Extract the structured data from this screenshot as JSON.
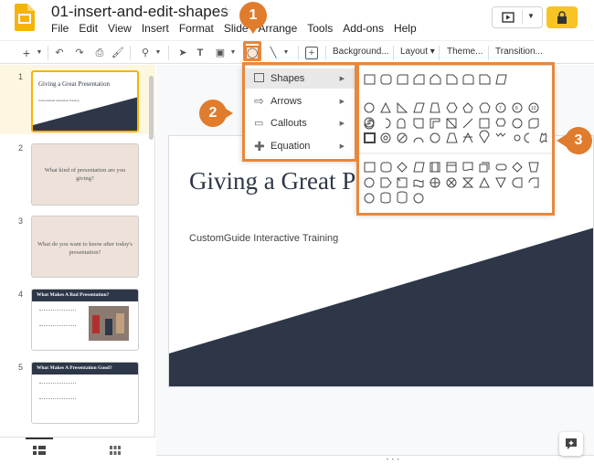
{
  "app": {
    "doc_title": "01-insert-and-edit-shapes",
    "menu": [
      "File",
      "Edit",
      "View",
      "Insert",
      "Format",
      "Slide",
      "Arrange",
      "Tools",
      "Add-ons",
      "Help"
    ]
  },
  "toolbar": {
    "background_label": "Background...",
    "layout_label": "Layout",
    "theme_label": "Theme...",
    "transition_label": "Transition..."
  },
  "filmstrip": {
    "slides": [
      {
        "num": "1",
        "title": "Giving a Great Presentation",
        "subtitle": "CustomGuide Interactive Training"
      },
      {
        "num": "2",
        "text": "What kind of presentation are you giving?"
      },
      {
        "num": "3",
        "text": "What do you want to know after today's presentation?"
      },
      {
        "num": "4",
        "title": "What Makes A Bad Presentation?"
      },
      {
        "num": "5",
        "title": "What Makes A Presentation Good?"
      }
    ]
  },
  "slide": {
    "title": "Giving a Great P",
    "subtitle": "CustomGuide Interactive Training"
  },
  "insert_menu": {
    "items": [
      {
        "label": "Shapes",
        "icon": "square-icon"
      },
      {
        "label": "Arrows",
        "icon": "arrow-icon"
      },
      {
        "label": "Callouts",
        "icon": "callout-icon"
      },
      {
        "label": "Equation",
        "icon": "plus-icon"
      }
    ]
  },
  "callouts": {
    "one": "1",
    "two": "2",
    "three": "3"
  },
  "colors": {
    "accent": "#e07c2d",
    "slide_dark": "#2d3748",
    "selected": "#f4b400"
  }
}
